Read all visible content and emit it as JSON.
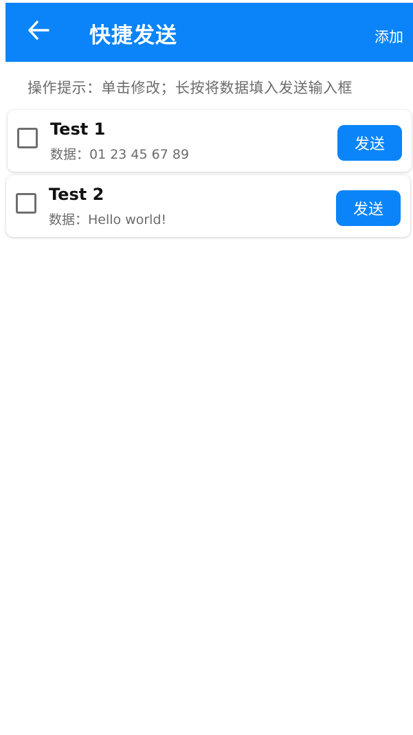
{
  "app_bar": {
    "title": "快捷发送",
    "add_label": "添加",
    "back_icon": "arrow-left-icon",
    "color": "#0a84f8"
  },
  "hint": "操作提示：单击修改；长按将数据填入发送输入框",
  "items": [
    {
      "title": "Test 1",
      "data": "数据：01 23 45 67 89",
      "send_label": "发送",
      "checked": false
    },
    {
      "title": "Test 2",
      "data": "数据：Hello world!",
      "send_label": "发送",
      "checked": false
    }
  ]
}
